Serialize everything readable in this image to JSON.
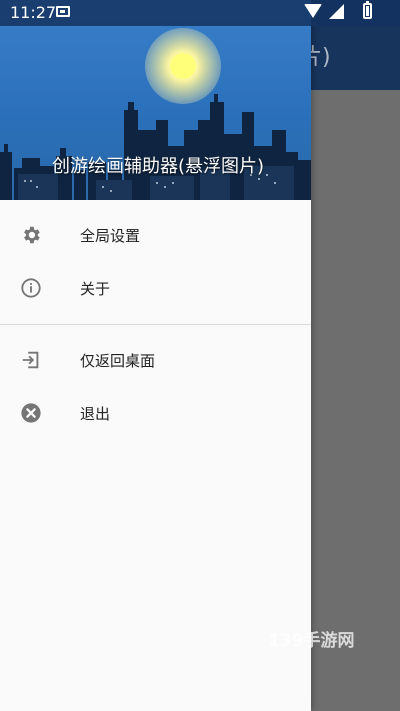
{
  "status_bar": {
    "time": "11:27"
  },
  "app": {
    "title_visible": "片)"
  },
  "drawer": {
    "header_title": "创游绘画辅助器(悬浮图片)",
    "menu": [
      {
        "label": "全局设置",
        "icon": "gear-icon"
      },
      {
        "label": "关于",
        "icon": "info-icon"
      },
      {
        "label": "仅返回桌面",
        "icon": "exit-to-app-icon"
      },
      {
        "label": "退出",
        "icon": "close-circle-icon"
      }
    ]
  },
  "watermark": "139手游网",
  "colors": {
    "header_blue": "#2a6fb9",
    "app_bar": "#17345c",
    "icon_gray": "#757575"
  }
}
